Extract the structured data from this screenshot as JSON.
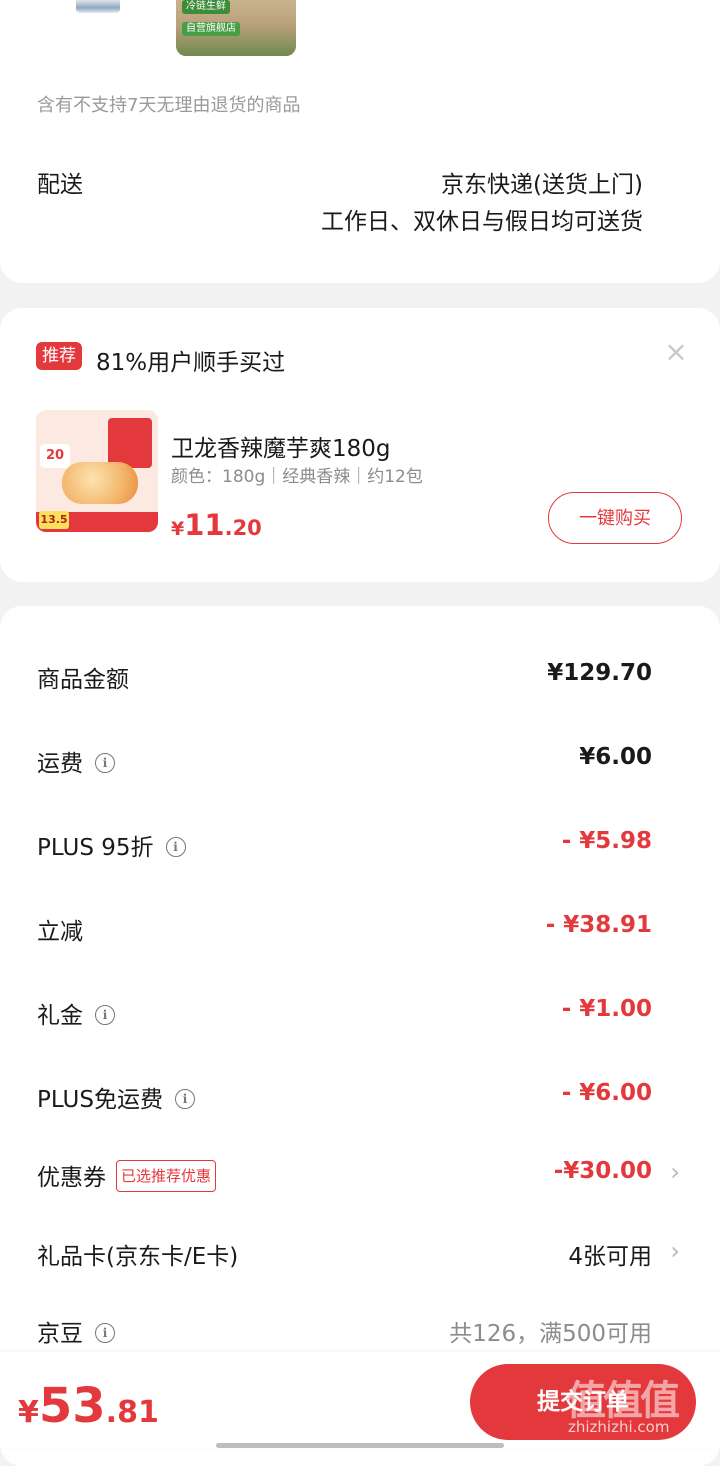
{
  "shipment": {
    "thumb2_tag_a": "冷链生鲜",
    "thumb2_tag_b": "自营旗舰店",
    "return_note": "含有不支持7天无理由退货的商品",
    "delivery_label": "配送",
    "delivery_method": "京东快递(送货上门)",
    "delivery_schedule": "工作日、双休日与假日均可送货"
  },
  "recommendation": {
    "badge": "推荐",
    "headline": "81%用户顺手买过",
    "close_glyph": "×",
    "image_badge_a": "20",
    "image_badge_b": "13.5",
    "product_name": "卫龙香辣魔芋爽180g",
    "product_spec": "颜色：180g｜经典香辣｜约12包",
    "price_currency": "¥",
    "price_int": "11",
    "price_dec": ".20",
    "buy_label": "一键购买"
  },
  "fees": {
    "info_glyph": "i",
    "chevron_glyph": "›",
    "rows": [
      {
        "label": "商品金额",
        "value": "¥129.70"
      },
      {
        "label": "运费",
        "value": "¥6.00"
      },
      {
        "label": "PLUS 95折",
        "value": "- ¥5.98"
      },
      {
        "label": "立减",
        "value": "- ¥38.91"
      },
      {
        "label": "礼金",
        "value": "- ¥1.00"
      },
      {
        "label": "PLUS免运费",
        "value": "- ¥6.00"
      },
      {
        "label": "优惠券",
        "tag": "已选推荐优惠",
        "value": "-¥30.00"
      },
      {
        "label": "礼品卡(京东卡/E卡)",
        "value": "4张可用"
      },
      {
        "label": "京豆",
        "value": "共126，满500可用"
      }
    ]
  },
  "bottom_bar": {
    "total_currency": "¥",
    "total_int": "53",
    "total_dec": ".81",
    "submit_label": "提交订单",
    "watermark": "值值值",
    "watermark_url": "zhizhizhi.com"
  },
  "colors": {
    "accent": "#e4393c",
    "background": "#f2f2f2",
    "card": "#ffffff",
    "muted_text": "#8c8c8c"
  }
}
